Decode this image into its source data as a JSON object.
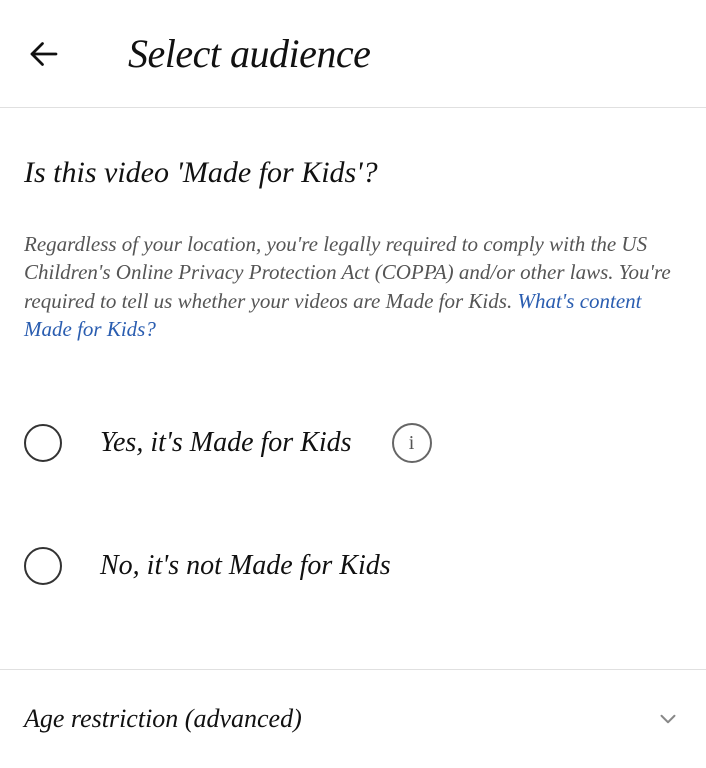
{
  "header": {
    "title": "Select audience"
  },
  "main": {
    "question": "Is this video 'Made for Kids'?",
    "description_pre": "Regardless of your location, you're legally required to comply with the US Children's Online Privacy Protection Act (COPPA) and/or other laws. You're required to tell us whether your videos are Made for Kids. ",
    "description_link": "What's content Made for Kids?",
    "options": [
      {
        "label": "Yes, it's Made for Kids",
        "has_info": true
      },
      {
        "label": "No, it's not Made for Kids",
        "has_info": false
      }
    ]
  },
  "advanced": {
    "label": "Age restriction (advanced)"
  },
  "icons": {
    "info_glyph": "i"
  }
}
